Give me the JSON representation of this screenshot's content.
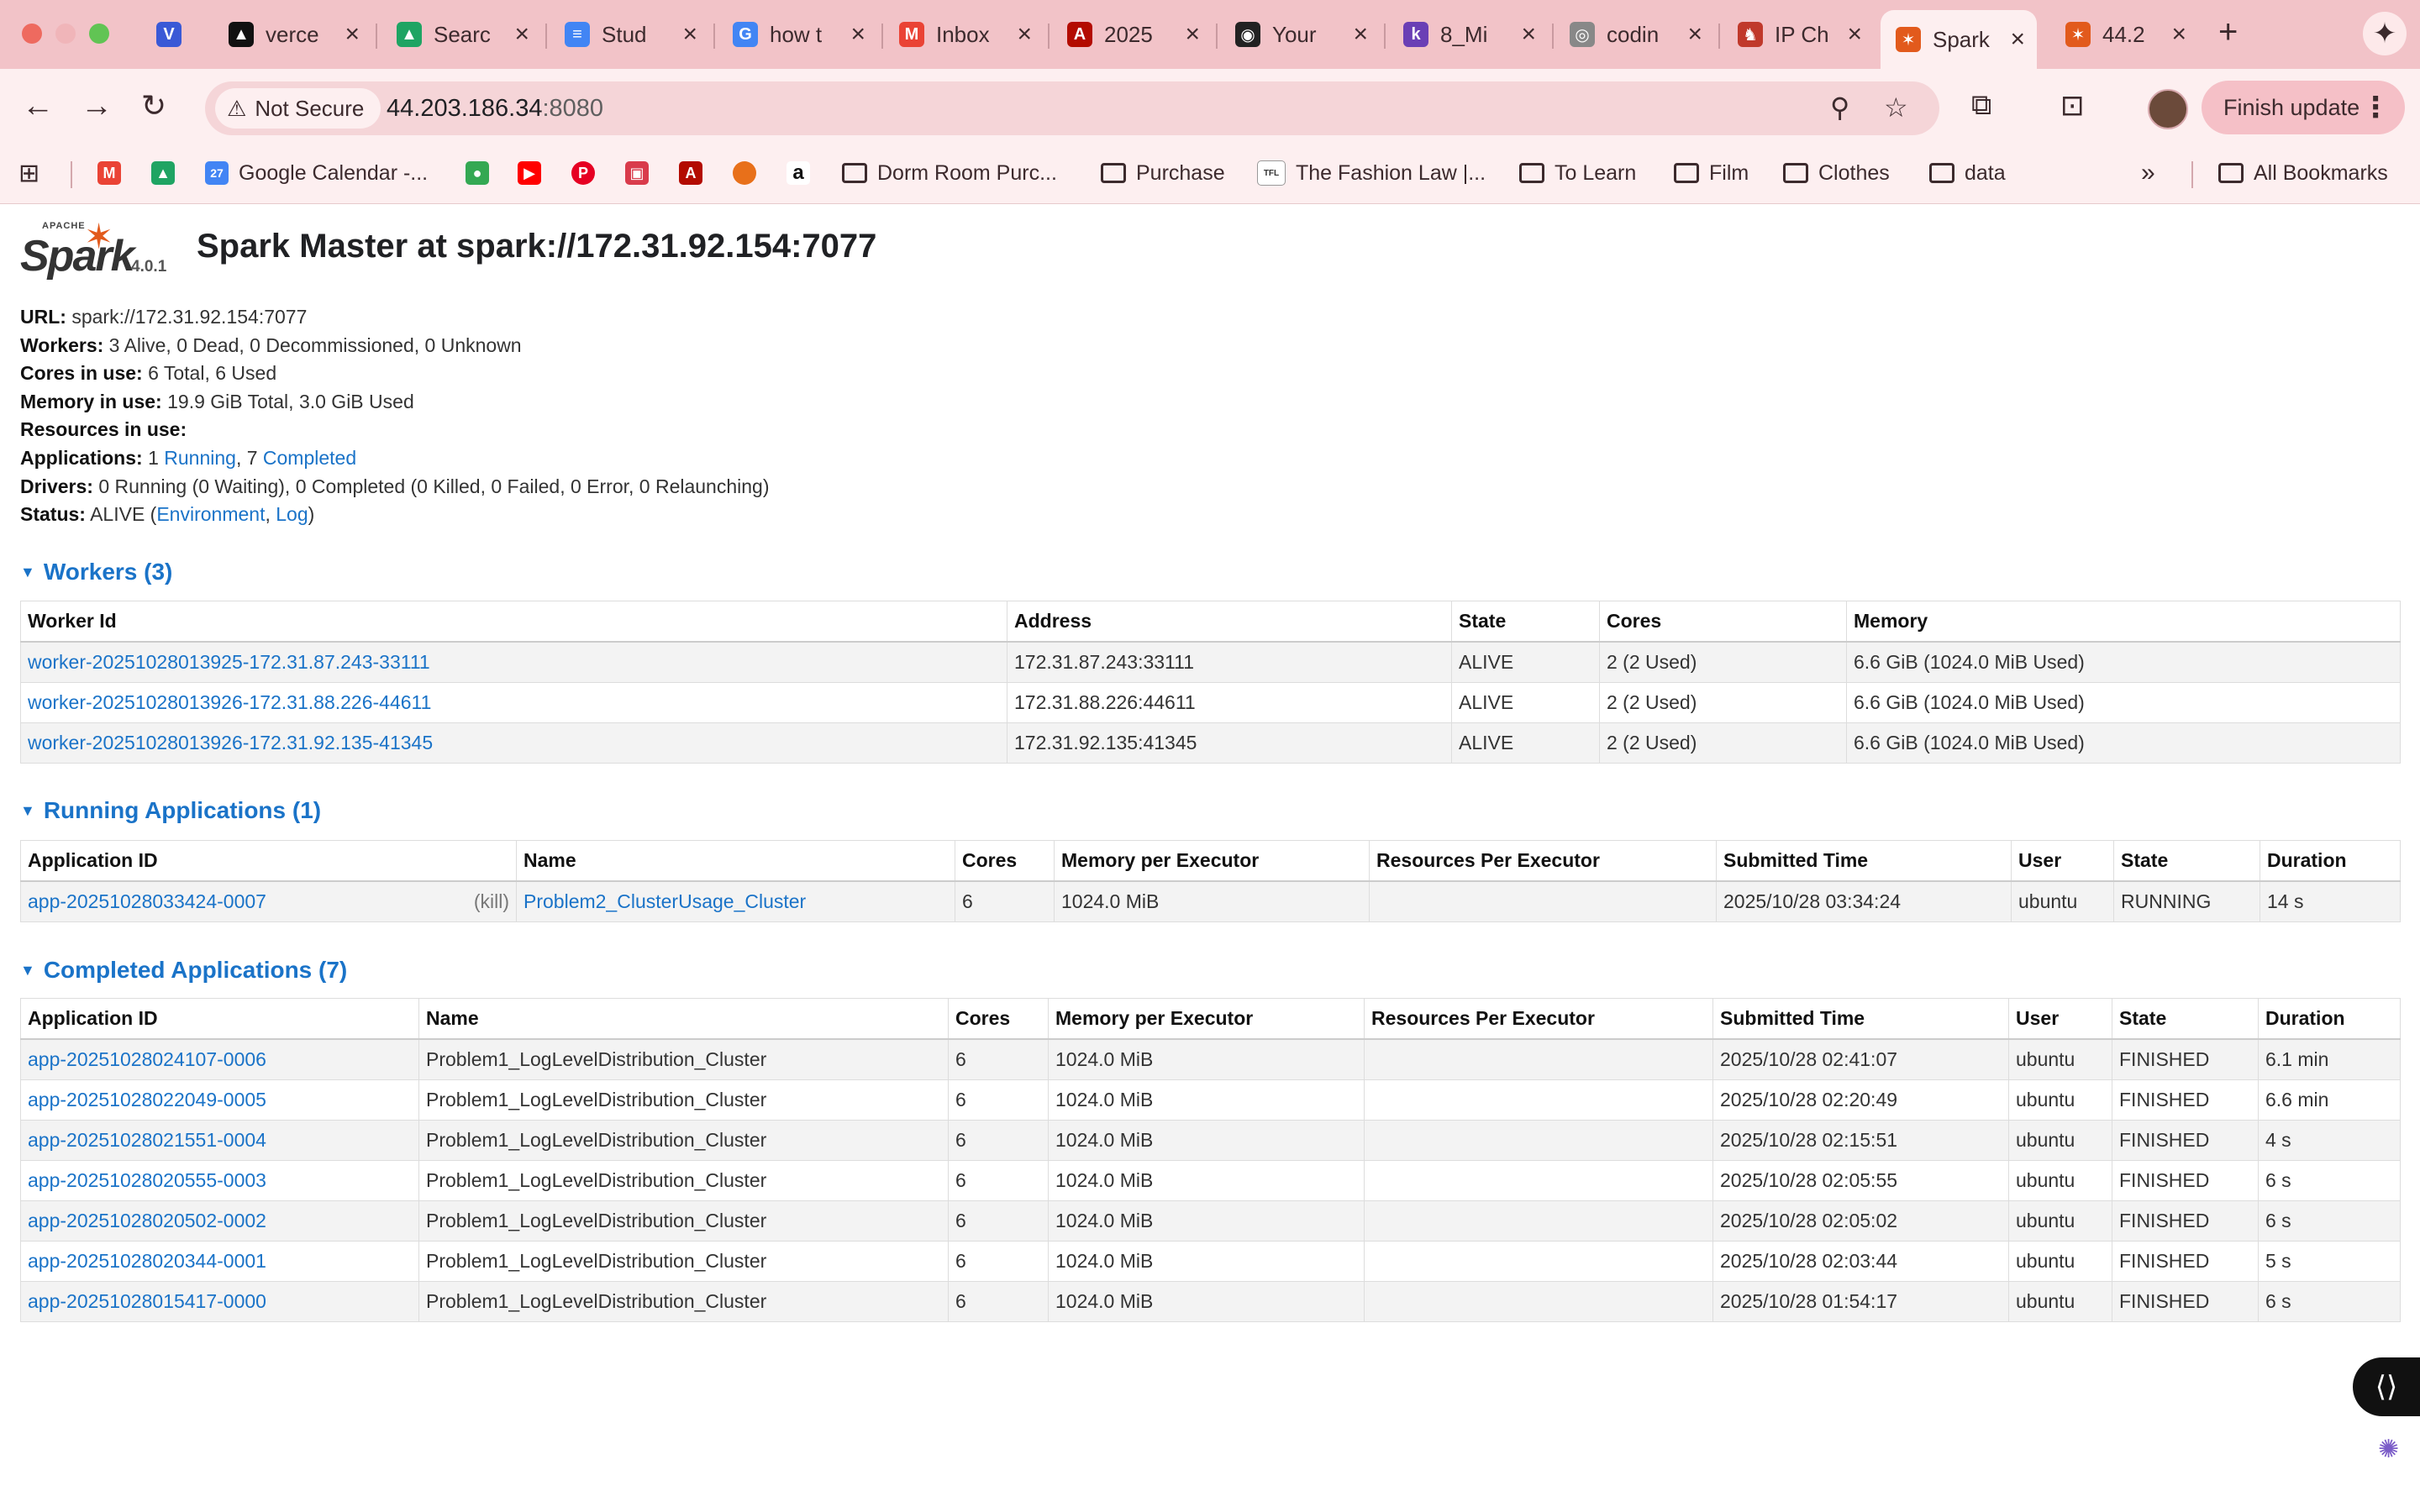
{
  "browser": {
    "tabs": [
      {
        "title": "verce",
        "icon": "vercel-icon"
      },
      {
        "title": "Searc",
        "icon": "google-drive-icon"
      },
      {
        "title": "Stud",
        "icon": "google-docs-icon"
      },
      {
        "title": "how t",
        "icon": "google-icon"
      },
      {
        "title": "Inbox",
        "icon": "gmail-icon"
      },
      {
        "title": "2025",
        "icon": "pdf-icon"
      },
      {
        "title": "Your",
        "icon": "github-icon"
      },
      {
        "title": "8_Mi",
        "icon": "k-icon"
      },
      {
        "title": "codin",
        "icon": "openai-icon"
      },
      {
        "title": "IP Ch",
        "icon": "horse-icon"
      },
      {
        "title": "Spark",
        "icon": "spark-icon"
      },
      {
        "title": "44.2",
        "icon": "spark-icon"
      }
    ],
    "first_tab_icon": "v-logo-icon",
    "not_secure_label": "Not Secure",
    "url_host": "44.203.186.34",
    "url_port": ":8080",
    "finish_update_label": "Finish update",
    "bookmarks": [
      {
        "label": "Google Calendar -...",
        "icon": "calendar-icon"
      },
      {
        "label": "Dorm Room Purc...",
        "icon": "folder-icon"
      },
      {
        "label": "Purchase",
        "icon": "folder-icon"
      },
      {
        "label": "The Fashion Law |...",
        "icon": "tfl-icon"
      },
      {
        "label": "To Learn",
        "icon": "folder-icon"
      },
      {
        "label": "Film",
        "icon": "folder-icon"
      },
      {
        "label": "Clothes",
        "icon": "folder-icon"
      },
      {
        "label": "data",
        "icon": "folder-icon"
      },
      {
        "label": "All Bookmarks",
        "icon": "folder-icon"
      }
    ],
    "calendar_day": "27",
    "tfl_badge": "TFL",
    "colors": {
      "chrome": "#f2c3c8",
      "toolbar": "#fdeff0",
      "link": "#1a73c8"
    }
  },
  "spark": {
    "logo_apache": "APACHE",
    "logo_spark": "Spark",
    "version": "4.0.1",
    "title": "Spark Master at spark://172.31.92.154:7077",
    "summary": {
      "url_label": "URL:",
      "url_value": "spark://172.31.92.154:7077",
      "workers_label": "Workers:",
      "workers_value": "3 Alive, 0 Dead, 0 Decommissioned, 0 Unknown",
      "cores_label": "Cores in use:",
      "cores_value": "6 Total, 6 Used",
      "memory_label": "Memory in use:",
      "memory_value": "19.9 GiB Total, 3.0 GiB Used",
      "resources_label": "Resources in use:",
      "apps_label": "Applications:",
      "apps_running_count": "1",
      "apps_running_link": "Running",
      "apps_sep": ", 7",
      "apps_completed_link": "Completed",
      "drivers_label": "Drivers:",
      "drivers_value": "0 Running (0 Waiting), 0 Completed (0 Killed, 0 Failed, 0 Error, 0 Relaunching)",
      "status_label": "Status:",
      "status_value": "ALIVE (",
      "status_env_link": "Environment",
      "status_comma": ", ",
      "status_log_link": "Log",
      "status_close": ")"
    },
    "workers": {
      "heading": "Workers (3)",
      "columns": [
        "Worker Id",
        "Address",
        "State",
        "Cores",
        "Memory"
      ],
      "rows": [
        {
          "id": "worker-20251028013925-172.31.87.243-33111",
          "address": "172.31.87.243:33111",
          "state": "ALIVE",
          "cores": "2 (2 Used)",
          "memory": "6.6 GiB (1024.0 MiB Used)"
        },
        {
          "id": "worker-20251028013926-172.31.88.226-44611",
          "address": "172.31.88.226:44611",
          "state": "ALIVE",
          "cores": "2 (2 Used)",
          "memory": "6.6 GiB (1024.0 MiB Used)"
        },
        {
          "id": "worker-20251028013926-172.31.92.135-41345",
          "address": "172.31.92.135:41345",
          "state": "ALIVE",
          "cores": "2 (2 Used)",
          "memory": "6.6 GiB (1024.0 MiB Used)"
        }
      ]
    },
    "running": {
      "heading": "Running Applications (1)",
      "columns": [
        "Application ID",
        "Name",
        "Cores",
        "Memory per Executor",
        "Resources Per Executor",
        "Submitted Time",
        "User",
        "State",
        "Duration"
      ],
      "rows": [
        {
          "id": "app-20251028033424-0007",
          "kill": "(kill)",
          "name": "Problem2_ClusterUsage_Cluster",
          "cores": "6",
          "memory": "1024.0 MiB",
          "resources": "",
          "submitted": "2025/10/28 03:34:24",
          "user": "ubuntu",
          "state": "RUNNING",
          "duration": "14 s"
        }
      ]
    },
    "completed": {
      "heading": "Completed Applications (7)",
      "columns": [
        "Application ID",
        "Name",
        "Cores",
        "Memory per Executor",
        "Resources Per Executor",
        "Submitted Time",
        "User",
        "State",
        "Duration"
      ],
      "rows": [
        {
          "id": "app-20251028024107-0006",
          "name": "Problem1_LogLevelDistribution_Cluster",
          "cores": "6",
          "memory": "1024.0 MiB",
          "resources": "",
          "submitted": "2025/10/28 02:41:07",
          "user": "ubuntu",
          "state": "FINISHED",
          "duration": "6.1 min"
        },
        {
          "id": "app-20251028022049-0005",
          "name": "Problem1_LogLevelDistribution_Cluster",
          "cores": "6",
          "memory": "1024.0 MiB",
          "resources": "",
          "submitted": "2025/10/28 02:20:49",
          "user": "ubuntu",
          "state": "FINISHED",
          "duration": "6.6 min"
        },
        {
          "id": "app-20251028021551-0004",
          "name": "Problem1_LogLevelDistribution_Cluster",
          "cores": "6",
          "memory": "1024.0 MiB",
          "resources": "",
          "submitted": "2025/10/28 02:15:51",
          "user": "ubuntu",
          "state": "FINISHED",
          "duration": "4 s"
        },
        {
          "id": "app-20251028020555-0003",
          "name": "Problem1_LogLevelDistribution_Cluster",
          "cores": "6",
          "memory": "1024.0 MiB",
          "resources": "",
          "submitted": "2025/10/28 02:05:55",
          "user": "ubuntu",
          "state": "FINISHED",
          "duration": "6 s"
        },
        {
          "id": "app-20251028020502-0002",
          "name": "Problem1_LogLevelDistribution_Cluster",
          "cores": "6",
          "memory": "1024.0 MiB",
          "resources": "",
          "submitted": "2025/10/28 02:05:02",
          "user": "ubuntu",
          "state": "FINISHED",
          "duration": "6 s"
        },
        {
          "id": "app-20251028020344-0001",
          "name": "Problem1_LogLevelDistribution_Cluster",
          "cores": "6",
          "memory": "1024.0 MiB",
          "resources": "",
          "submitted": "2025/10/28 02:03:44",
          "user": "ubuntu",
          "state": "FINISHED",
          "duration": "5 s"
        },
        {
          "id": "app-20251028015417-0000",
          "name": "Problem1_LogLevelDistribution_Cluster",
          "cores": "6",
          "memory": "1024.0 MiB",
          "resources": "",
          "submitted": "2025/10/28 01:54:17",
          "user": "ubuntu",
          "state": "FINISHED",
          "duration": "6 s"
        }
      ]
    }
  }
}
